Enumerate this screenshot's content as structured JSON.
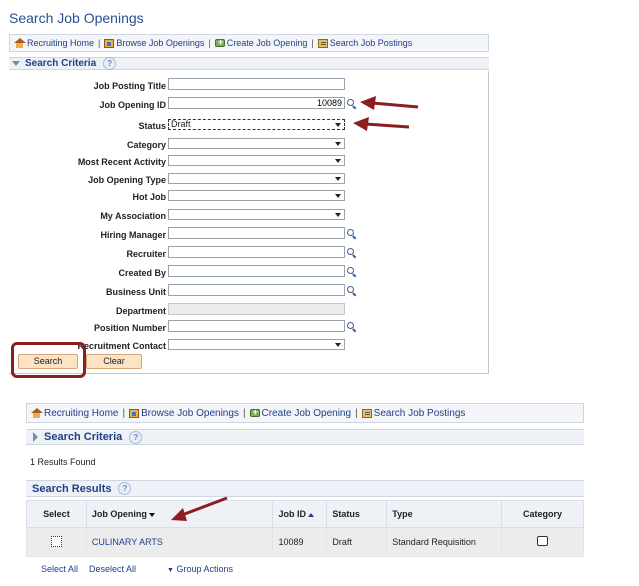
{
  "page": {
    "title": "Search Job Openings"
  },
  "toolbar": {
    "recruiting_home": "Recruiting Home",
    "browse_job_openings": "Browse Job Openings",
    "create_job_opening": "Create Job Opening",
    "search_job_postings": "Search Job Postings",
    "separator": "|"
  },
  "search_criteria": {
    "title": "Search Criteria",
    "help_glyph": "?",
    "fields": {
      "job_posting_title": {
        "label": "Job Posting Title",
        "value": ""
      },
      "job_opening_id": {
        "label": "Job Opening ID",
        "value": "10089"
      },
      "status": {
        "label": "Status",
        "value": "Draft"
      },
      "category": {
        "label": "Category",
        "value": ""
      },
      "most_recent_activity": {
        "label": "Most Recent Activity",
        "value": ""
      },
      "job_opening_type": {
        "label": "Job Opening Type",
        "value": ""
      },
      "hot_job": {
        "label": "Hot Job",
        "value": ""
      },
      "my_association": {
        "label": "My Association",
        "value": ""
      },
      "hiring_manager": {
        "label": "Hiring Manager",
        "value": ""
      },
      "recruiter": {
        "label": "Recruiter",
        "value": ""
      },
      "created_by": {
        "label": "Created By",
        "value": ""
      },
      "business_unit": {
        "label": "Business Unit",
        "value": ""
      },
      "department": {
        "label": "Department",
        "value": ""
      },
      "position_number": {
        "label": "Position Number",
        "value": ""
      },
      "recruitment_contact": {
        "label": "Recruitment Contact",
        "value": ""
      }
    },
    "buttons": {
      "search": "Search",
      "clear": "Clear"
    }
  },
  "results": {
    "toolbar": {
      "recruiting_home": "Recruiting Home",
      "browse_job_openings": "Browse Job Openings",
      "create_job_opening": "Create Job Opening",
      "search_job_postings": "Search Job Postings",
      "separator": "|"
    },
    "criteria_title": "Search Criteria",
    "found": "1 Results Found",
    "title": "Search Results",
    "columns": {
      "select": "Select",
      "job_opening": "Job Opening",
      "job_id": "Job ID",
      "status": "Status",
      "type": "Type",
      "category": "Category"
    },
    "rows": [
      {
        "job_opening": "CULINARY ARTS",
        "job_id": "10089",
        "status": "Draft",
        "type": "Standard Requisition"
      }
    ],
    "footer": {
      "select_all": "Select All",
      "deselect_all": "Deselect All",
      "group_actions": "Group Actions"
    }
  },
  "colors": {
    "accent": "#1f3f8b",
    "annotation": "#8b1e1e",
    "button": "#fbe3c3"
  },
  "icons": [
    "home-icon",
    "browse-icon",
    "create-icon",
    "postings-icon",
    "lookup-icon",
    "help-icon",
    "collapse-triangle-icon",
    "expand-triangle-icon",
    "sort-desc-icon",
    "sort-asc-icon",
    "annotation-arrow"
  ]
}
